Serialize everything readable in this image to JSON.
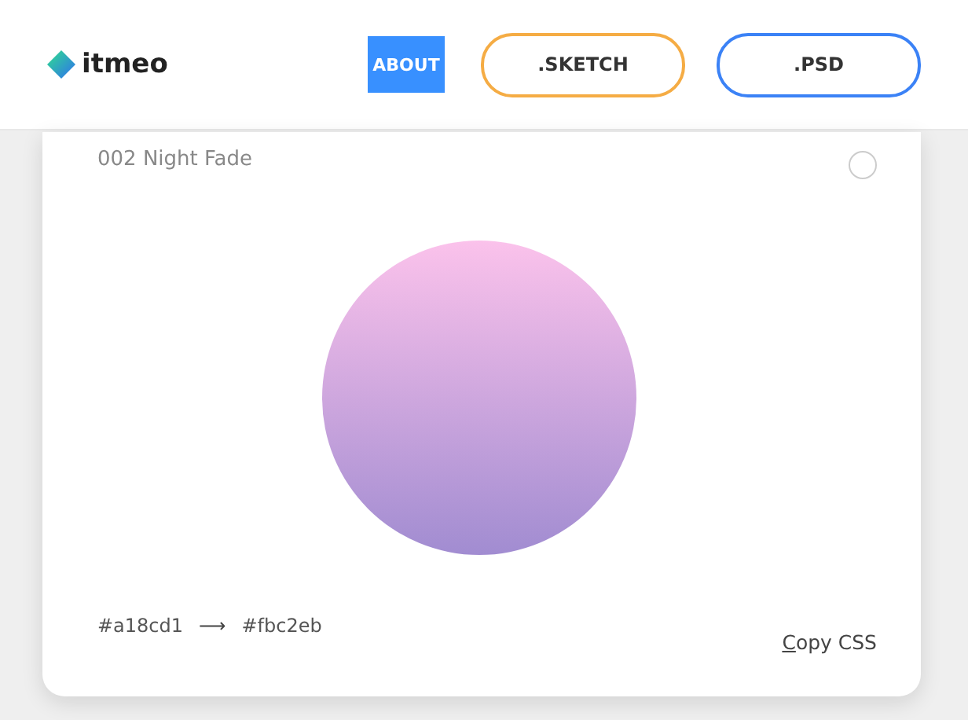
{
  "header": {
    "brand": "itmeo",
    "nav": [
      {
        "label": "ABOUT",
        "kind": "filled",
        "color": "#3890ff"
      },
      {
        "label": ".SKETCH",
        "kind": "outline",
        "color": "#f5ac44"
      },
      {
        "label": ".PSD",
        "kind": "outline",
        "color": "#3b82f6"
      }
    ]
  },
  "card": {
    "title": "002 Night Fade",
    "from_color": "#a18cd1",
    "to_color": "#fbc2eb",
    "arrow": "⟶",
    "copy_button": "Copy CSS"
  }
}
